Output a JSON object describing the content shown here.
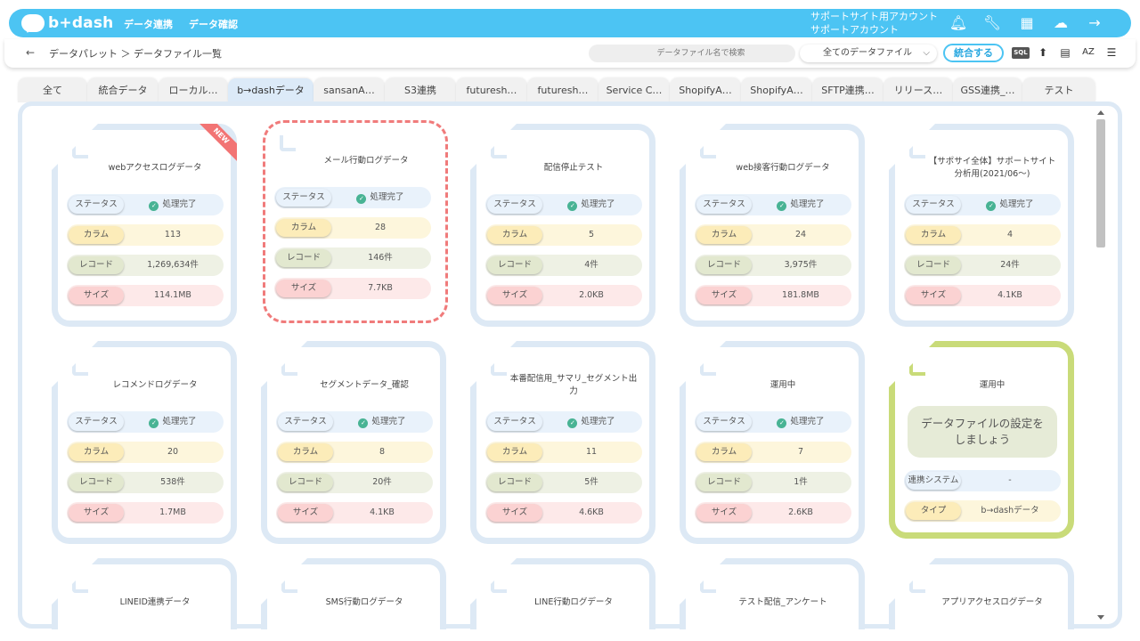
{
  "header": {
    "logo_text": "b+dash",
    "nav": [
      "データ連携",
      "データ確認"
    ],
    "account_line1": "サポートサイト用アカウント",
    "account_line2": "サポートアカウント"
  },
  "toolbar": {
    "back": "←",
    "breadcrumb": "データパレット ＞ データファイル一覧",
    "search_placeholder": "データファイル名で検索",
    "filter_value": "全てのデータファイル",
    "merge_label": "統合する",
    "sql_label": "SQL",
    "sort_label": "AZ"
  },
  "tabs": [
    "全て",
    "統合データ",
    "ローカル…",
    "b→dashデータ",
    "sansanA…",
    "S3連携",
    "futuresh…",
    "futuresh…",
    "Service C…",
    "ShopifyA…",
    "ShopifyA…",
    "SFTP連携…",
    "リリース…",
    "GSS連携_…",
    "テスト"
  ],
  "labels": {
    "status": "ステータス",
    "column": "カラム",
    "record": "レコード",
    "size": "サイズ",
    "system": "連携システム",
    "type": "タイプ",
    "new": "NEW"
  },
  "cards": [
    {
      "title": "webアクセスログデータ",
      "status": "処理完了",
      "columns": "113",
      "records": "1,269,634件",
      "size": "114.1MB"
    },
    {
      "title": "メール行動ログデータ",
      "status": "処理完了",
      "columns": "28",
      "records": "146件",
      "size": "7.7KB"
    },
    {
      "title": "配信停止テスト",
      "status": "処理完了",
      "columns": "5",
      "records": "4件",
      "size": "2.0KB"
    },
    {
      "title": "web接客行動ログデータ",
      "status": "処理完了",
      "columns": "24",
      "records": "3,975件",
      "size": "181.8MB"
    },
    {
      "title": "【サポサイ全体】サポートサイト分析用(2021/06〜)",
      "status": "処理完了",
      "columns": "4",
      "records": "24件",
      "size": "4.1KB"
    },
    {
      "title": "レコメンドログデータ",
      "status": "処理完了",
      "columns": "20",
      "records": "538件",
      "size": "1.7MB"
    },
    {
      "title": "セグメントデータ_確認",
      "status": "処理完了",
      "columns": "8",
      "records": "20件",
      "size": "4.1KB"
    },
    {
      "title": "本番配信用_サマリ_セグメント出力",
      "status": "処理完了",
      "columns": "11",
      "records": "5件",
      "size": "4.6KB"
    },
    {
      "title": "運用中",
      "status": "処理完了",
      "columns": "7",
      "records": "1件",
      "size": "2.6KB"
    }
  ],
  "setup_card": {
    "title": "運用中",
    "cta": "データファイルの設定をしましょう",
    "system": "-",
    "type": "b→dashデータ"
  },
  "bottom_cards": [
    "LINEID連携データ",
    "SMS行動ログデータ",
    "LINE行動ログデータ",
    "テスト配信_アンケート",
    "アプリアクセスログデータ"
  ]
}
